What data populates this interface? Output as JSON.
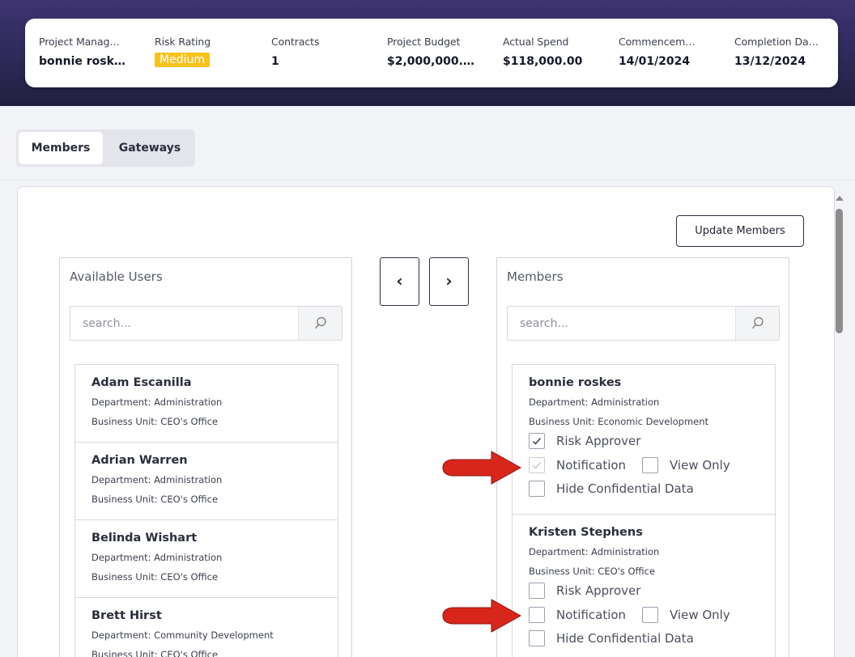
{
  "summary": {
    "project_manager": {
      "label": "Project Manag…",
      "value": "bonnie rosk…"
    },
    "risk_rating": {
      "label": "Risk Rating",
      "value": "Medium",
      "color": "#f7c21a"
    },
    "contracts": {
      "label": "Contracts",
      "value": "1"
    },
    "project_budget": {
      "label": "Project Budget",
      "value": "$2,000,000.…"
    },
    "actual_spend": {
      "label": "Actual Spend",
      "value": "$118,000.00"
    },
    "commencement": {
      "label": "Commencem…",
      "value": "14/01/2024"
    },
    "completion": {
      "label": "Completion Da…",
      "value": "13/12/2024"
    }
  },
  "tabs": [
    {
      "label": "Members",
      "active": true
    },
    {
      "label": "Gateways",
      "active": false
    }
  ],
  "update_button": "Update Members",
  "transfer": {
    "left_icon": "chevron-left-icon",
    "right_icon": "chevron-right-icon",
    "left_glyph": "‹",
    "right_glyph": "›"
  },
  "available_users": {
    "title": "Available Users",
    "search_placeholder": "search...",
    "users": [
      {
        "name": "Adam Escanilla",
        "department": "Department: Administration",
        "business_unit": "Business Unit: CEO's Office"
      },
      {
        "name": "Adrian Warren",
        "department": "Department: Administration",
        "business_unit": "Business Unit: CEO's Office"
      },
      {
        "name": "Belinda Wishart",
        "department": "Department: Administration",
        "business_unit": "Business Unit: CEO's Office"
      },
      {
        "name": "Brett Hirst",
        "department": "Department: Community Development",
        "business_unit": "Business Unit: CEO's Office"
      }
    ]
  },
  "members": {
    "title": "Members",
    "search_placeholder": "search...",
    "option_labels": {
      "risk_approver": "Risk Approver",
      "notification": "Notification",
      "view_only": "View Only",
      "hide_confidential": "Hide Confidential Data"
    },
    "list": [
      {
        "name": "bonnie roskes",
        "department": "Department: Administration",
        "business_unit": "Business Unit: Economic Development",
        "risk_approver": true,
        "notification": true,
        "notification_disabled": true,
        "view_only": false,
        "hide_confidential": false
      },
      {
        "name": "Kristen Stephens",
        "department": "Department: Administration",
        "business_unit": "Business Unit: CEO's Office",
        "risk_approver": false,
        "notification": false,
        "notification_disabled": false,
        "view_only": false,
        "hide_confidential": false
      }
    ]
  },
  "colors": {
    "header_bg": "#2e2a5a",
    "annotation_arrow": "#d9261c",
    "badge": "#f7c21a"
  }
}
